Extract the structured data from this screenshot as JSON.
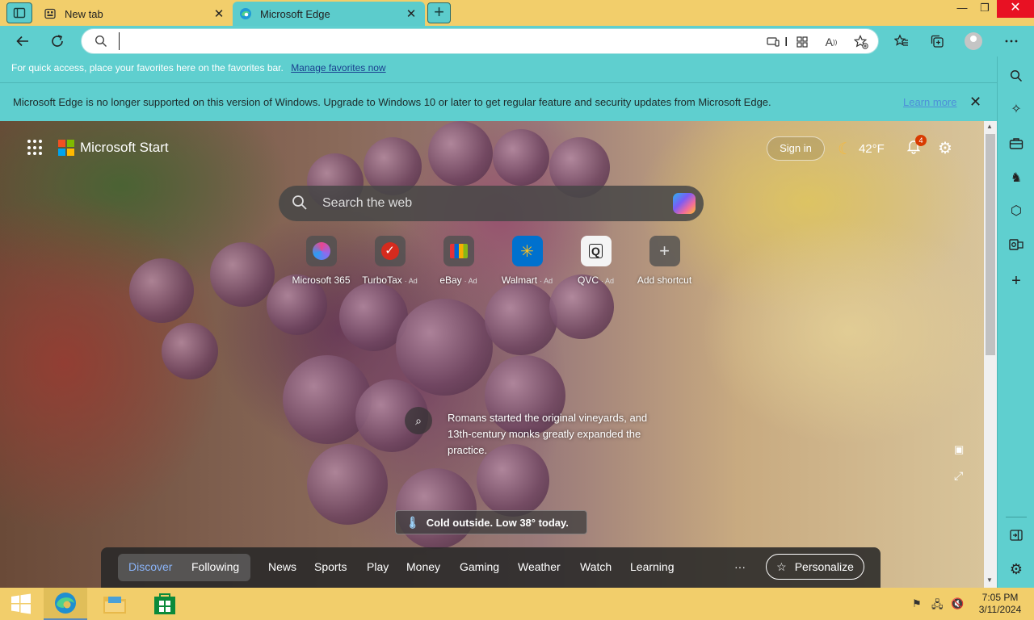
{
  "tabs": [
    {
      "label": "New tab",
      "close": "✕"
    },
    {
      "label": "Microsoft Edge",
      "close": "✕"
    }
  ],
  "window_controls": {
    "minimize": "—",
    "restore": "❐",
    "close": "✕"
  },
  "toolbar": {
    "address_value": "",
    "icons": [
      "back-icon",
      "refresh-icon",
      "search-icon",
      "app-available-icon",
      "extensions-icon",
      "read-aloud-icon",
      "add-favorite-icon",
      "favorites-icon",
      "collections-icon",
      "profile-icon",
      "more-icon"
    ]
  },
  "favorites_bar": {
    "text": "For quick access, place your favorites here on the favorites bar.",
    "link": "Manage favorites now"
  },
  "info_bar": {
    "text": "Microsoft Edge is no longer supported on this version of Windows. Upgrade to Windows 10 or later to get regular feature and security updates from Microsoft Edge.",
    "link": "Learn more"
  },
  "newtab_page": {
    "brand": "Microsoft Start",
    "sign_in": "Sign in",
    "weather": "42°F",
    "notifications_count": "4",
    "search_placeholder": "Search the web",
    "shortcuts": [
      {
        "name": "Microsoft 365",
        "ad": ""
      },
      {
        "name": "TurboTax",
        "ad": "· Ad"
      },
      {
        "name": "eBay",
        "ad": "· Ad"
      },
      {
        "name": "Walmart",
        "ad": "· Ad"
      },
      {
        "name": "QVC",
        "ad": "· Ad"
      },
      {
        "name": "Add shortcut",
        "ad": ""
      }
    ],
    "fact": "Romans started the original vineyards, and 13th-century monks greatly expanded the practice.",
    "weather_banner": "Cold outside. Low 38° today.",
    "nav": {
      "discover": "Discover",
      "following": "Following",
      "items": [
        "News",
        "Sports",
        "Play",
        "Money",
        "Gaming",
        "Weather",
        "Watch",
        "Learning"
      ],
      "more": "···",
      "personalize": "Personalize"
    }
  },
  "sidebar_icons": [
    "search-icon",
    "copilot-icon",
    "shopping-icon",
    "games-icon",
    "microsoft365-icon",
    "outlook-icon",
    "add-icon",
    "hide-sidebar-icon",
    "settings-icon"
  ],
  "taskbar": {
    "time": "7:05 PM",
    "date": "3/11/2024"
  },
  "colors": {
    "chrome_teal": "#5fcfcf",
    "tab_strip_yellow": "#f2ce6b",
    "close_red": "#e81123",
    "nav_active": "#8ab4f8"
  }
}
